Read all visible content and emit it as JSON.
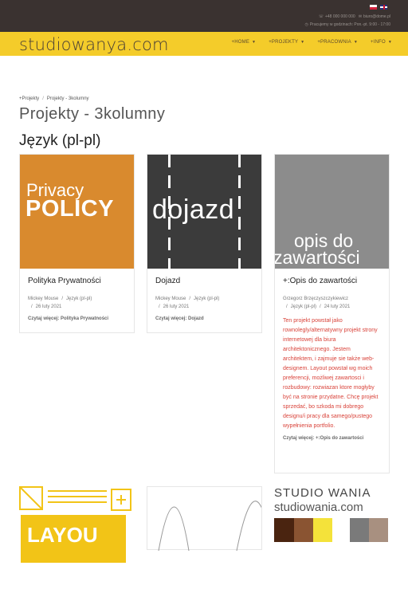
{
  "header": {
    "phone": "+48 000 000 000",
    "email": "biuro@dome.pl",
    "hours": "Pracujemy w godzinach: Pon.-pt. 9:00 - 17:00"
  },
  "nav": {
    "logo": "studiowanya.com",
    "items": [
      {
        "label": "+HOME"
      },
      {
        "label": "+PROJEKTY"
      },
      {
        "label": "+PRACOWNIA"
      },
      {
        "label": "+INFO"
      }
    ]
  },
  "breadcrumb": {
    "home": "+Projekty",
    "current": "Projekty - 3kolumny",
    "sep": "/"
  },
  "page": {
    "title": "Projekty - 3kolumny",
    "section": "Język (pl-pl)"
  },
  "cards": [
    {
      "image_line1": "Privacy",
      "image_line2": "POLICY",
      "title": "Polityka Prywatności",
      "author": "Mickey Mouse",
      "language": "Język (pl-pl)",
      "date": "26 luty 2021",
      "read_more_label": "Czytaj więcej:",
      "read_more_target": "Polityka Prywatności"
    },
    {
      "image_text": "dojazd",
      "title": "Dojazd",
      "author": "Mickey Mouse",
      "language": "Język (pl-pl)",
      "date": "26 luty 2021",
      "read_more_label": "Czytaj więcej:",
      "read_more_target": "Dojazd"
    },
    {
      "image_line1": "opis do",
      "image_line2": "zawartości",
      "title": "+:Opis do zawartości",
      "author": "Grzegorz Brzęczyszczykiewicz",
      "language": "Język (pl-pl)",
      "date": "24 luty 2021",
      "text": "Ten projekt powstał jako rownolegly/alternatywny projekt strony internetowej dla biura architektonicznego. Jestem architektem, i zajmuje sie także web-designem. Layout powstał wg moich preferencji, możliwej zawartosci i rozbudowy: rozwiazan ktore mogłyby być na stronie przydatne. Chcę projekt sprzedać, bo szkoda mi dobrego designu/i pracy dla samego/pustego wypełnienia portfolio.",
      "read_more_label": "Czytaj więcej:",
      "read_more_target": "+:Opis do zawartości"
    }
  ],
  "bottom_cards": [
    {
      "image_text": "LAYOU"
    },
    {
      "image_text": ""
    },
    {
      "image_line1": "STUDIO WANIA",
      "image_line2": "studiowania.com"
    }
  ],
  "colors": {
    "topbar": "#3a3230",
    "navbar": "#f4cc2a",
    "accent_text": "#d9433a",
    "privacy_bg": "#d98a2e",
    "dojazd_bg": "#3b3b3b",
    "opis_bg": "#8c8c8c"
  }
}
